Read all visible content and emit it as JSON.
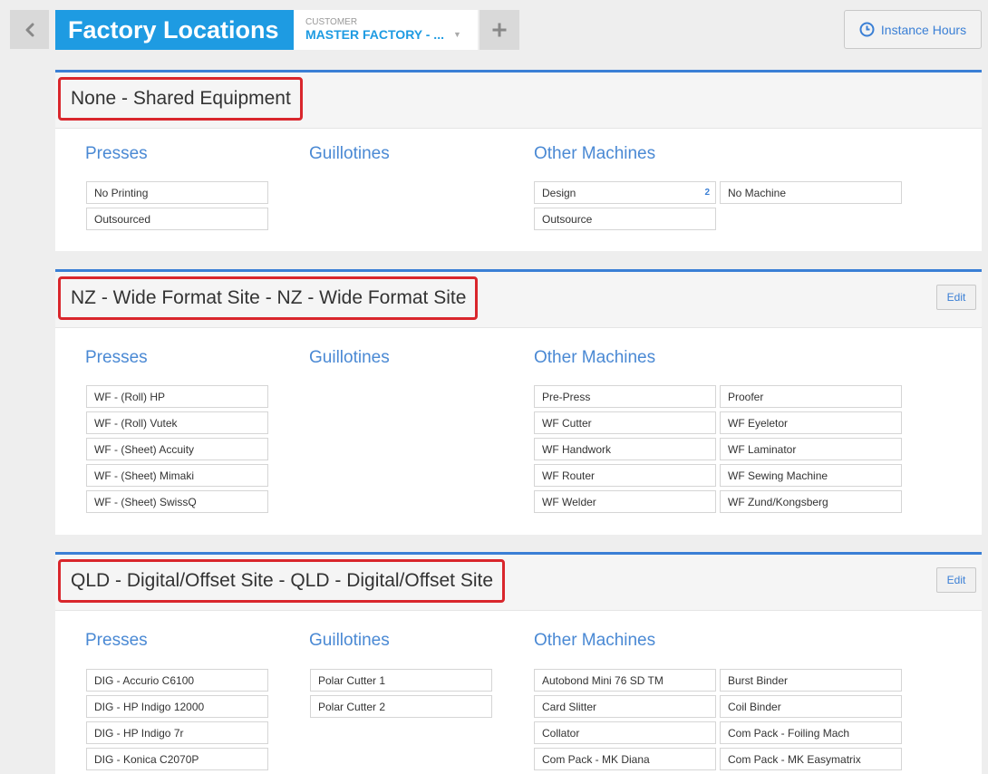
{
  "header": {
    "title": "Factory Locations",
    "customer_label": "CUSTOMER",
    "customer_value": "MASTER FACTORY - ...",
    "instance_hours_label": "Instance Hours"
  },
  "column_headings": {
    "presses": "Presses",
    "guillotines": "Guillotines",
    "other": "Other Machines"
  },
  "edit_label": "Edit",
  "sites": [
    {
      "name": "None - Shared Equipment",
      "presses": [
        "No Printing",
        "Outsourced"
      ],
      "guillotines": [],
      "other": [
        {
          "name": "Design",
          "badge": "2"
        },
        {
          "name": "No Machine"
        },
        {
          "name": "Outsource"
        }
      ]
    },
    {
      "name": "NZ - Wide Format Site - NZ - Wide Format Site",
      "presses": [
        "WF - (Roll) HP",
        "WF - (Roll) Vutek",
        "WF - (Sheet) Accuity",
        "WF - (Sheet) Mimaki",
        "WF - (Sheet) SwissQ"
      ],
      "guillotines": [],
      "other": [
        {
          "name": "Pre-Press"
        },
        {
          "name": "Proofer"
        },
        {
          "name": "WF Cutter"
        },
        {
          "name": "WF Eyeletor"
        },
        {
          "name": "WF Handwork"
        },
        {
          "name": "WF Laminator"
        },
        {
          "name": "WF Router"
        },
        {
          "name": "WF Sewing Machine"
        },
        {
          "name": "WF Welder"
        },
        {
          "name": "WF Zund/Kongsberg"
        }
      ]
    },
    {
      "name": "QLD - Digital/Offset Site - QLD - Digital/Offset Site",
      "presses": [
        "DIG - Accurio C6100",
        "DIG - HP Indigo 12000",
        "DIG - HP Indigo 7r",
        "DIG - Konica C2070P",
        ""
      ],
      "guillotines": [
        "Polar Cutter 1",
        "Polar Cutter 2"
      ],
      "other": [
        {
          "name": "Autobond Mini 76 SD TM"
        },
        {
          "name": "Burst Binder"
        },
        {
          "name": "Card Slitter"
        },
        {
          "name": "Coil Binder"
        },
        {
          "name": "Collator"
        },
        {
          "name": "Com Pack - Foiling Mach"
        },
        {
          "name": "Com Pack - MK Diana"
        },
        {
          "name": "Com Pack - MK Easymatrix"
        },
        {
          "name": ""
        },
        {
          "name": ""
        }
      ]
    }
  ]
}
